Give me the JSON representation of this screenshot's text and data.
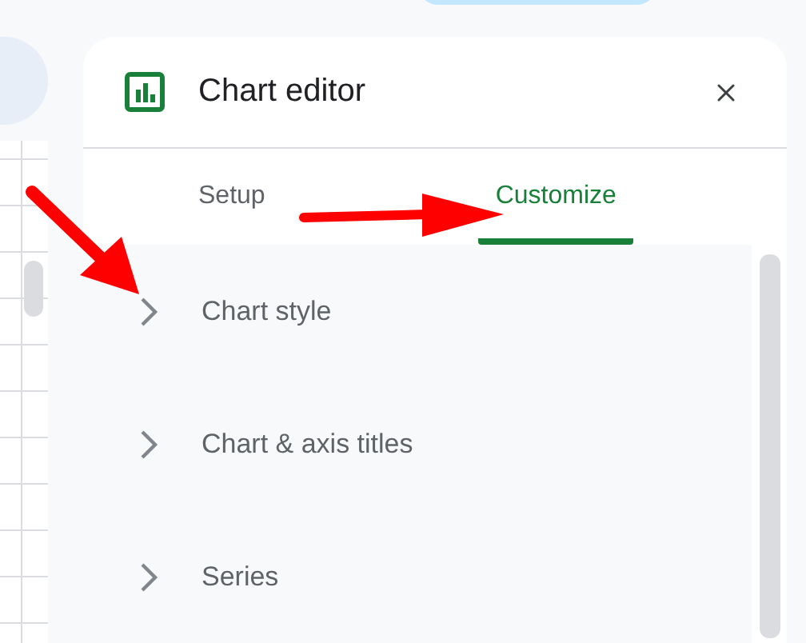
{
  "panel": {
    "title": "Chart editor"
  },
  "tabs": [
    {
      "label": "Setup",
      "selected": false
    },
    {
      "label": "Customize",
      "selected": true
    }
  ],
  "sections": [
    {
      "label": "Chart style",
      "expanded": false
    },
    {
      "label": "Chart & axis titles",
      "expanded": false
    },
    {
      "label": "Series",
      "expanded": false
    }
  ]
}
